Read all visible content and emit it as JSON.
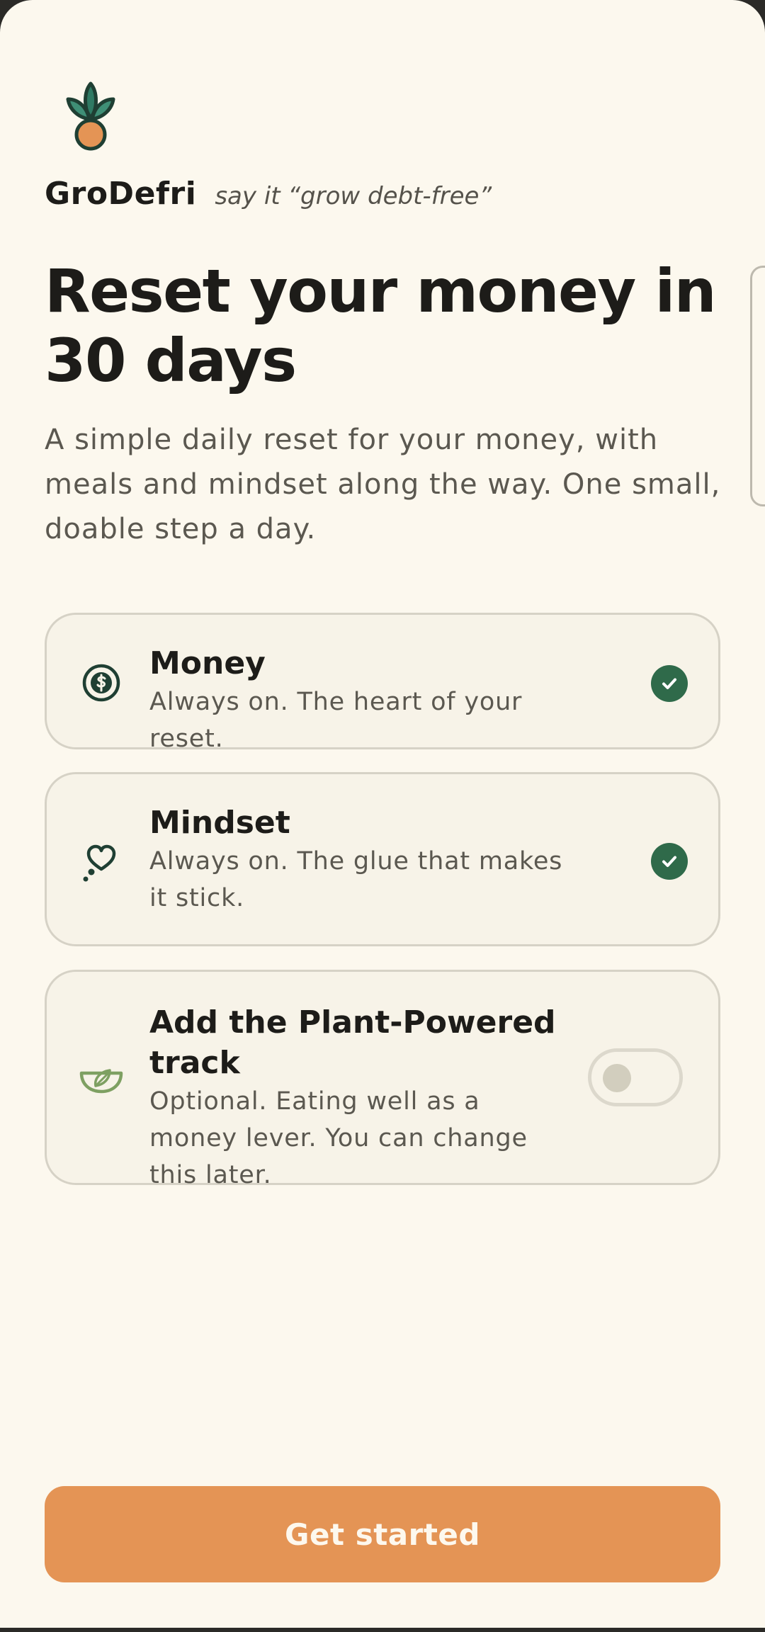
{
  "brand": {
    "name": "GroDefri",
    "tagline": "say it “grow debt-free”",
    "logo_icon": "sprout-seed-icon"
  },
  "hero": {
    "headline": "Reset your money in 30 days",
    "subtitle": "A simple daily reset for your money, with meals and mindset along the way. One small, doable step a day."
  },
  "options": {
    "money": {
      "icon": "dollar-coin-icon",
      "title": "Money",
      "description": "Always on. The heart of your reset.",
      "checked": true
    },
    "mindset": {
      "icon": "heart-thought-icon",
      "title": "Mindset",
      "description": "Always on. The glue that makes it stick.",
      "checked": true
    },
    "plant": {
      "icon": "leaf-bowl-icon",
      "title": "Add the Plant-Powered track",
      "description": "Optional. Eating well as a money lever. You can change this later.",
      "enabled": false
    }
  },
  "cta": {
    "label": "Get started"
  },
  "colors": {
    "background": "#fcf8ee",
    "card": "#f7f3e8",
    "accent_green": "#2f6a4a",
    "accent_orange": "#e49455",
    "text_dark": "#1d1c19",
    "text_muted": "#5b5850"
  }
}
